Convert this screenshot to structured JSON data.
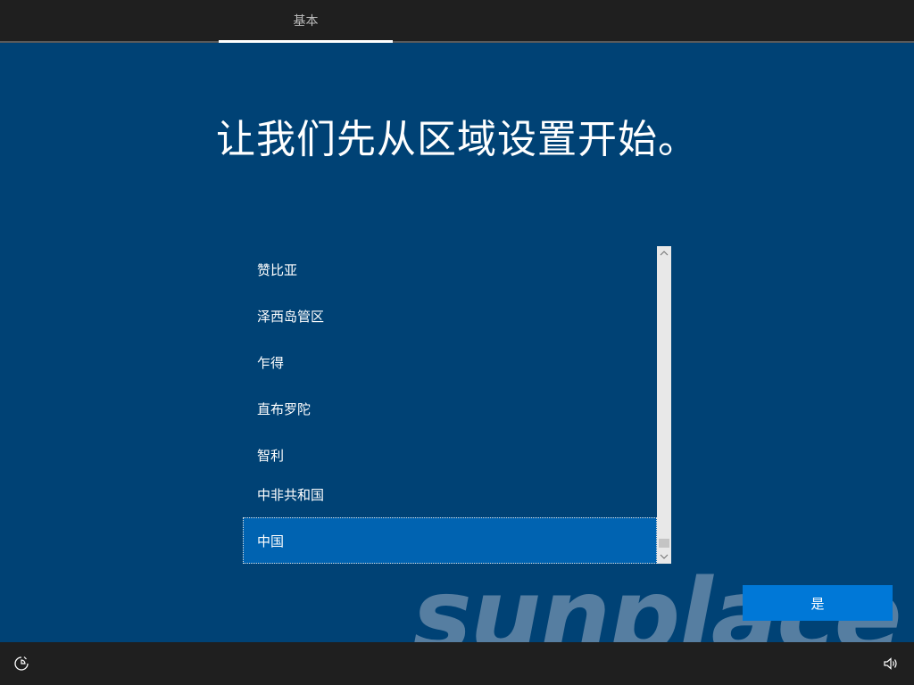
{
  "header": {
    "tab_label": "基本"
  },
  "main": {
    "heading": "让我们先从区域设置开始。"
  },
  "region_list": {
    "items": [
      {
        "label": "赞比亚"
      },
      {
        "label": "泽西岛管区"
      },
      {
        "label": "乍得"
      },
      {
        "label": "直布罗陀"
      },
      {
        "label": "智利"
      },
      {
        "label": "中非共和国"
      },
      {
        "label": "中国"
      }
    ],
    "selected_label": "中国"
  },
  "actions": {
    "yes_label": "是"
  },
  "watermark": {
    "text": "sunplace"
  },
  "icons": {
    "accessibility": "ease-of-access-icon",
    "volume": "volume-icon"
  },
  "colors": {
    "background": "#004275",
    "selected": "#0063b1",
    "button": "#0078d7",
    "bars": "#1f1f1f"
  }
}
